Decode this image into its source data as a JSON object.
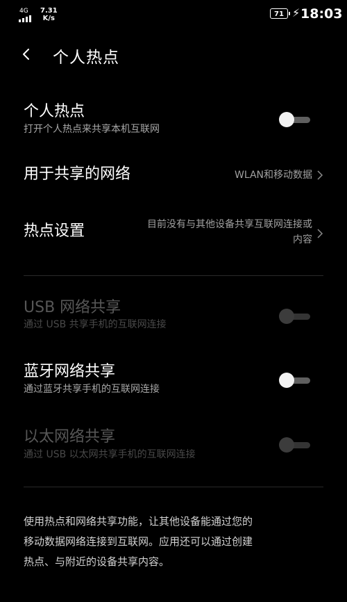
{
  "status_bar": {
    "network_type": "4G",
    "speed_value": "7.31",
    "speed_unit": "K/s",
    "battery": "71",
    "time": "18:03"
  },
  "header": {
    "title": "个人热点",
    "back_icon": "chevron-left-icon"
  },
  "rows": {
    "hotspot": {
      "title": "个人热点",
      "subtitle": "打开个人热点来共享本机互联网",
      "toggle_on": false,
      "enabled": true
    },
    "network": {
      "title": "用于共享的网络",
      "value": "WLAN和移动数据"
    },
    "settings": {
      "title": "热点设置",
      "value_line1": "目前没有与其他设备共享互联网连接或",
      "value_line2": "内容"
    },
    "usb": {
      "title": "USB 网络共享",
      "subtitle": "通过 USB 共享手机的互联网连接",
      "toggle_on": false,
      "enabled": false
    },
    "bluetooth": {
      "title": "蓝牙网络共享",
      "subtitle": "通过蓝牙共享手机的互联网连接",
      "toggle_on": false,
      "enabled": true
    },
    "ethernet": {
      "title": "以太网络共享",
      "subtitle": "通过 USB 以太网共享手机的互联网连接",
      "toggle_on": false,
      "enabled": false
    }
  },
  "footer": {
    "line1": "使用热点和网络共享功能，让其他设备能通过您的",
    "line2": "移动数据网络连接到互联网。应用还可以通过创建",
    "line3": "热点、与附近的设备共享内容。"
  },
  "colors": {
    "background": "#000000",
    "text": "#ffffff",
    "secondary": "#a8a8a8",
    "disabled": "#575757"
  }
}
